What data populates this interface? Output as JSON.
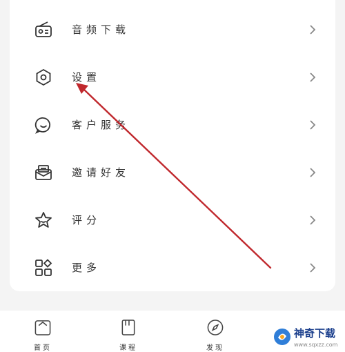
{
  "menu": {
    "items": [
      {
        "label": "音频下载",
        "icon": "radio-icon"
      },
      {
        "label": "设置",
        "icon": "gear-icon"
      },
      {
        "label": "客户服务",
        "icon": "chat-smile-icon"
      },
      {
        "label": "邀请好友",
        "icon": "mail-invite-icon"
      },
      {
        "label": "评分",
        "icon": "star-icon"
      },
      {
        "label": "更多",
        "icon": "grid-more-icon"
      }
    ]
  },
  "tabbar": {
    "tabs": [
      {
        "label": "首页",
        "icon": "home-icon"
      },
      {
        "label": "课程",
        "icon": "book-icon"
      },
      {
        "label": "发现",
        "icon": "compass-icon"
      }
    ]
  },
  "watermark": {
    "name": "神奇下载",
    "url": "www.sqxzz.com"
  },
  "colors": {
    "annotation_arrow": "#c0282d",
    "background": "#f4f4f4",
    "card": "#ffffff"
  }
}
